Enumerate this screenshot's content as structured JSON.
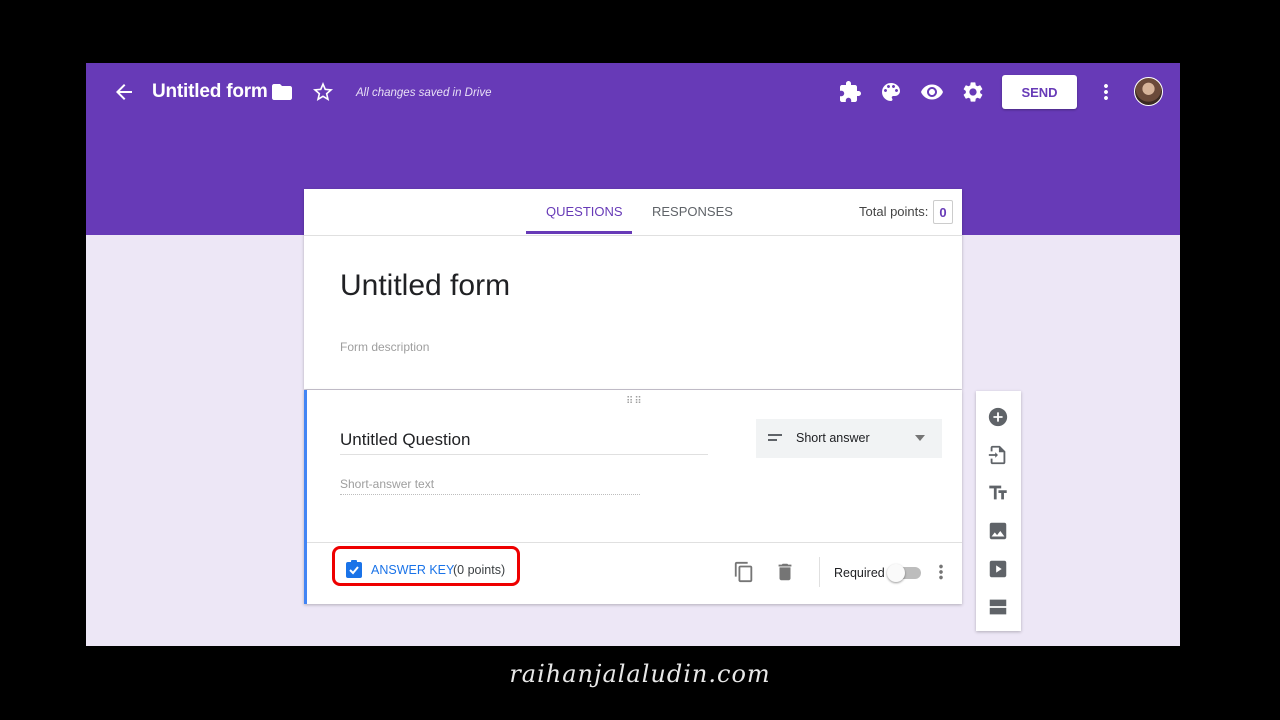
{
  "header": {
    "title": "Untitled form",
    "saved_status": "All changes saved in Drive",
    "send_label": "SEND",
    "colors": {
      "brand": "#673ab7",
      "background": "#ede7f6"
    },
    "icons": [
      "back-arrow-icon",
      "folder-icon",
      "star-icon",
      "addon-puzzle-icon",
      "palette-icon",
      "preview-eye-icon",
      "settings-gear-icon",
      "more-vert-icon"
    ]
  },
  "tabs": [
    {
      "label": "QUESTIONS",
      "active": true
    },
    {
      "label": "RESPONSES",
      "active": false
    }
  ],
  "total_points": {
    "label": "Total points:",
    "value": "0"
  },
  "form": {
    "title": "Untitled form",
    "description_placeholder": "Form description"
  },
  "question": {
    "title": "Untitled Question",
    "type": "Short answer",
    "answer_placeholder": "Short-answer text",
    "answer_key_label": "ANSWER KEY",
    "points_text": "(0 points)",
    "required_label": "Required",
    "required": false
  },
  "side_tools": [
    "add-question-icon",
    "import-questions-icon",
    "add-title-icon",
    "add-image-icon",
    "add-video-icon",
    "add-section-icon"
  ],
  "watermark": "raihanjalaludin.com"
}
